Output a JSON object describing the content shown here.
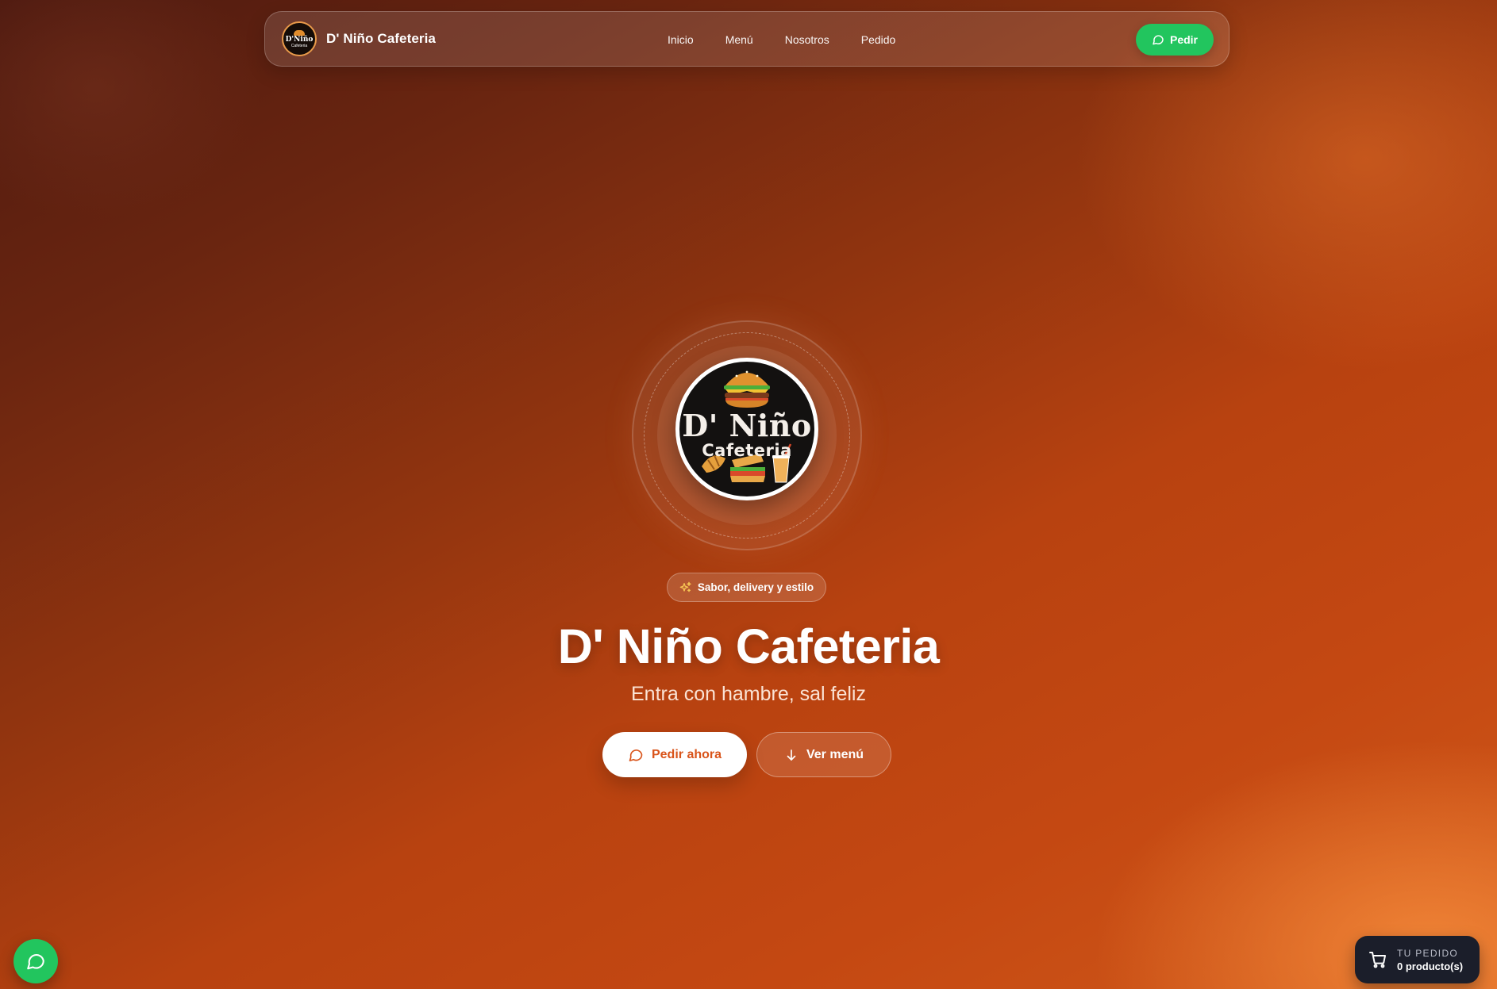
{
  "brand": {
    "name": "D' Niño Cafeteria",
    "logo_text_1": "D'Niño",
    "logo_text_2": "Cafeteria"
  },
  "nav": {
    "links": [
      {
        "label": "Inicio"
      },
      {
        "label": "Menú"
      },
      {
        "label": "Nosotros"
      },
      {
        "label": "Pedido"
      }
    ],
    "cta_label": "Pedir"
  },
  "hero": {
    "logo_title": "D' Niño",
    "logo_subtitle": "Cafeteria",
    "tagline": "Sabor, delivery y estilo",
    "title": "D' Niño Cafeteria",
    "subtitle": "Entra con hambre, sal feliz",
    "primary_button": "Pedir ahora",
    "secondary_button": "Ver menú"
  },
  "cart": {
    "label": "TU PEDIDO",
    "count_text": "0 producto(s)"
  },
  "icons": {
    "chat": "chat-bubble-icon",
    "sparkles": "sparkles-icon",
    "arrow": "arrow-down-icon",
    "cart": "shopping-cart-icon"
  },
  "colors": {
    "accent_green": "#22c55e",
    "primary_orange": "#d9541a",
    "cart_bg": "#1b1e2a"
  }
}
